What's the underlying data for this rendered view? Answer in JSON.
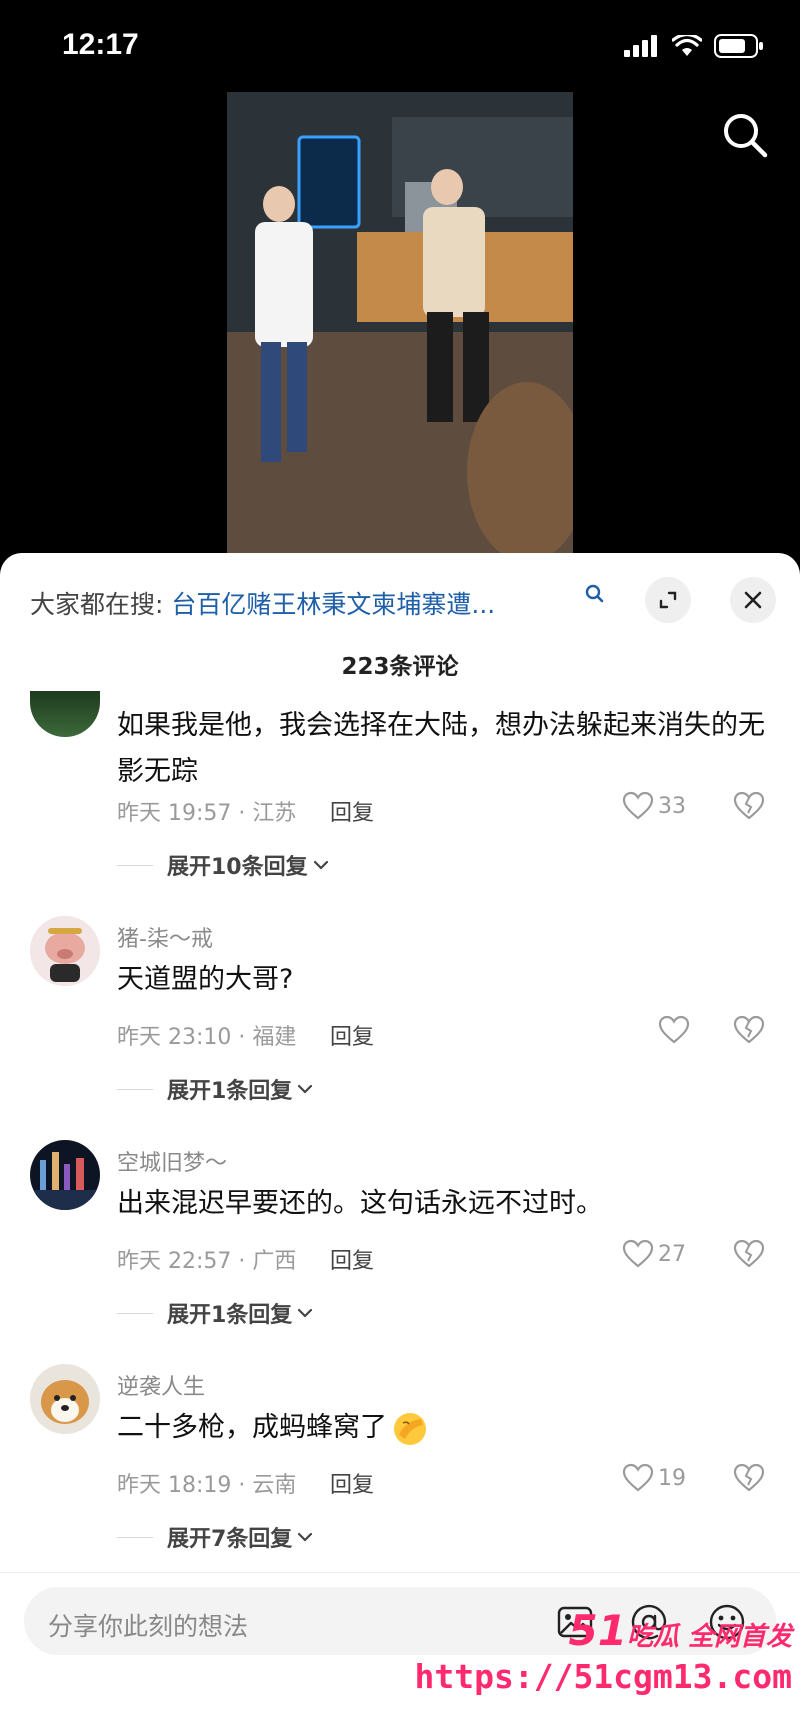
{
  "status_bar": {
    "time": "12:17"
  },
  "trending": {
    "label": "大家都在搜:",
    "query": "台百亿赌王林秉文柬埔寨遭..."
  },
  "comment_count": "223条评论",
  "comments": [
    {
      "name": "",
      "text": "如果我是他，我会选择在大陆，想办法躲起来消失的无影无踪",
      "meta": "昨天 19:57 · 江苏",
      "reply": "回复",
      "likes": "33",
      "expand": "展开10条回复"
    },
    {
      "name": "猪-柒～戒",
      "text": "天道盟的大哥?",
      "meta": "昨天 23:10 · 福建",
      "reply": "回复",
      "likes": "",
      "expand": "展开1条回复"
    },
    {
      "name": "空城旧梦～",
      "text": "出来混迟早要还的。这句话永远不过时。",
      "meta": "昨天 22:57 · 广西",
      "reply": "回复",
      "likes": "27",
      "expand": "展开1条回复"
    },
    {
      "name": "逆袭人生",
      "text": "二十多枪，成蚂蜂窝了",
      "meta": "昨天 18:19 · 云南",
      "reply": "回复",
      "likes": "19",
      "expand": "展开7条回复"
    }
  ],
  "input": {
    "placeholder": "分享你此刻的想法"
  },
  "watermark": {
    "brand_num": "51",
    "brand_text": "吃瓜 全网首发",
    "url": "https://51cgm13.com"
  },
  "icons": {
    "search": "search-icon",
    "expand": "expand-icon",
    "close": "close-icon",
    "like": "heart-icon",
    "dislike": "broken-heart-icon",
    "image": "image-icon",
    "mention": "at-icon",
    "emoji": "emoji-icon"
  },
  "colors": {
    "link": "#1f5fa8",
    "watermark": "#ff2a6e"
  }
}
